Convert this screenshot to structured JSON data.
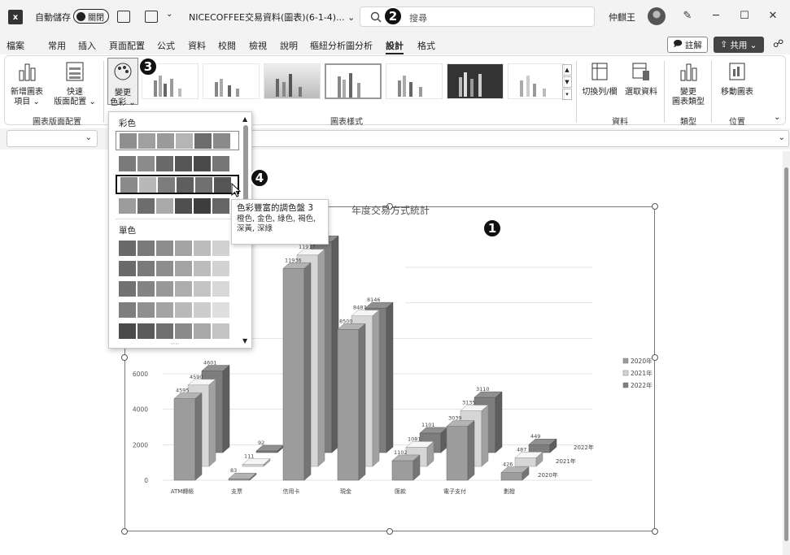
{
  "titlebar": {
    "autosave_label": "自動儲存",
    "autosave_state": "關閉",
    "doc_title": "NICECOFFEE交易資料(圖表)(6-1-4)... ⌄",
    "search_placeholder": "搜尋",
    "user_name": "仲麒王"
  },
  "menu": [
    "檔案",
    "常用",
    "插入",
    "頁面配置",
    "公式",
    "資料",
    "校閱",
    "檢視",
    "說明",
    "樞紐分析圖分析",
    "設計",
    "格式"
  ],
  "menu_active": "設計",
  "comment_label": "註解",
  "share_label": "共用 ⌄",
  "ribbon": {
    "add_element": "新增圖表\n項目 ⌄",
    "quick_layout": "快速\n版面配置 ⌄",
    "change_colors": "變更\n色彩 ⌄",
    "group_layouts": "圖表版面配置",
    "group_styles": "圖表樣式",
    "switch_rowcol": "切換列/欄",
    "select_data": "選取資料",
    "group_data": "資料",
    "change_type": "變更\n圖表類型",
    "group_type": "類型",
    "move_chart": "移動圖表",
    "group_location": "位置"
  },
  "dropdown": {
    "colorful_header": "彩色",
    "mono_header": "單色",
    "more": "····"
  },
  "tooltip": {
    "title": "色彩豐富的調色盤 3",
    "desc": "橙色, 金色, 綠色, 褐色, 深黃, 深綠"
  },
  "badges": [
    "1",
    "2",
    "3",
    "4"
  ],
  "chart_data": {
    "type": "bar",
    "title": "年度交易方式統計",
    "categories": [
      "ATM轉帳",
      "支票",
      "信用卡",
      "現金",
      "匯款",
      "電子支付",
      "劃撥"
    ],
    "series": [
      {
        "name": "2020年",
        "values": [
          4595,
          83,
          11936,
          8500,
          1102,
          3039,
          426
        ]
      },
      {
        "name": "2021年",
        "values": [
          4590,
          111,
          11917,
          8487,
          1081,
          3135,
          487
        ]
      },
      {
        "name": "2022年",
        "values": [
          4601,
          92,
          11899,
          8146,
          1101,
          3110,
          449
        ]
      }
    ],
    "ytick_labels": [
      "0",
      "2000",
      "4000",
      "6000",
      "8000"
    ],
    "ylim": [
      0,
      12000
    ],
    "legend_position": "right",
    "colors": [
      "#9c9c9c",
      "#d6d6d6",
      "#7d7d7d"
    ]
  }
}
